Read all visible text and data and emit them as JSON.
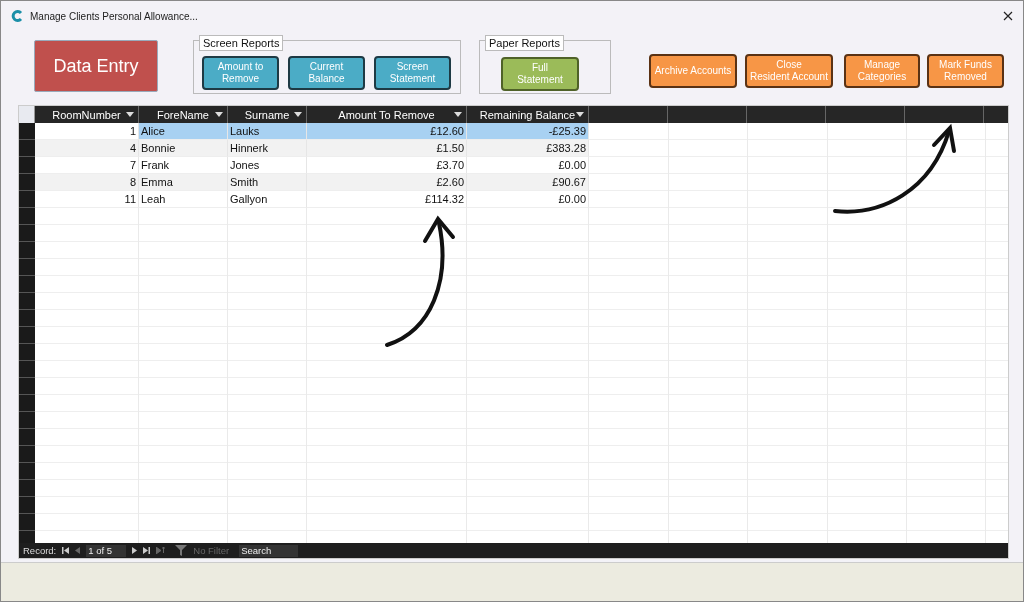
{
  "window": {
    "title": "Manage Clients Personal Allowance..."
  },
  "toolbar": {
    "data_entry_button": "Data Entry",
    "screen_reports": {
      "label": "Screen Reports",
      "buttons": [
        "Amount to\nRemove",
        "Current\nBalance",
        "Screen\nStatement"
      ]
    },
    "paper_reports": {
      "label": "Paper Reports",
      "buttons": [
        "Full\nStatement"
      ]
    },
    "action_buttons": [
      "Archive Accounts",
      "Close\nResident Account",
      "Manage\nCategories",
      "Mark Funds\nRemoved"
    ]
  },
  "table": {
    "columns": [
      "RoomNumber",
      "ForeName",
      "Surname",
      "Amount To Remove",
      "Remaining Balance"
    ],
    "rows": [
      {
        "selected": true,
        "cells": [
          "1",
          "Alice",
          "Lauks",
          "£12.60",
          "-£25.39"
        ]
      },
      {
        "selected": false,
        "cells": [
          "4",
          "Bonnie",
          "Hinnerk",
          "£1.50",
          "£383.28"
        ]
      },
      {
        "selected": false,
        "cells": [
          "7",
          "Frank",
          "Jones",
          "£3.70",
          "£0.00"
        ]
      },
      {
        "selected": false,
        "cells": [
          "8",
          "Emma",
          "Smith",
          "£2.60",
          "£90.67"
        ]
      },
      {
        "selected": false,
        "cells": [
          "11",
          "Leah",
          "Gallyon",
          "£114.32",
          "£0.00"
        ]
      }
    ]
  },
  "navigation": {
    "label": "Record:",
    "position": "1 of 5",
    "filter": "No Filter",
    "search_placeholder": "Search"
  }
}
